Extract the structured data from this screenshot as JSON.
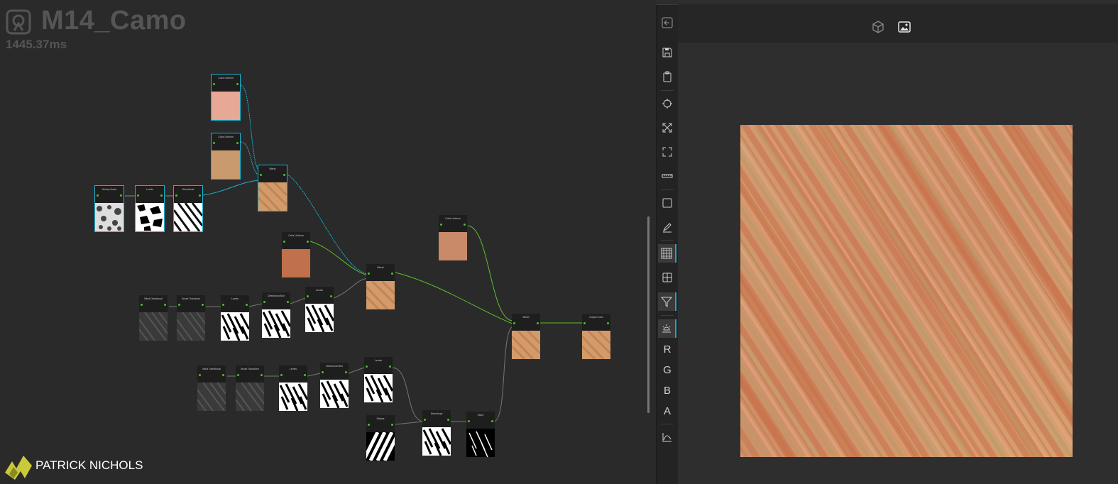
{
  "graph": {
    "title": "M14_Camo",
    "timing": "1445.37ms",
    "credit_name": "PATRICK NICHOLS",
    "nodes": [
      {
        "label": "Color Uniform",
        "thumb": "#e8a896",
        "sel": true
      },
      {
        "label": "Color Uniform",
        "thumb": "#c99a6e",
        "sel": true
      },
      {
        "label": "Blend",
        "thumb": "tex-tan",
        "sel": true
      },
      {
        "label": "Worley Noise",
        "thumb": "tex-worley",
        "sel": true
      },
      {
        "label": "Levels",
        "thumb": "tex-blot",
        "sel": true
      },
      {
        "label": "Directional",
        "thumb": "tex-streak",
        "sel": true
      },
      {
        "label": "Color Uniform",
        "thumb": "#c0704a",
        "sel": false
      },
      {
        "label": "Color Uniform",
        "thumb": "#c98a6a",
        "sel": false
      },
      {
        "label": "Blend",
        "thumb": "tex-tan",
        "sel": false
      },
      {
        "label": "Blend",
        "thumb": "tex-tan",
        "sel": false
      },
      {
        "label": "Output Color",
        "thumb": "tex-tan",
        "sel": false
      },
      {
        "label": "Wind Directional",
        "thumb": "tex-dark",
        "sel": false
      },
      {
        "label": "Smart Transform",
        "thumb": "tex-dark",
        "sel": false
      },
      {
        "label": "Levels",
        "thumb": "tex-bw",
        "sel": false
      },
      {
        "label": "Directional Blur",
        "thumb": "tex-bw",
        "sel": false
      },
      {
        "label": "Levels",
        "thumb": "tex-bw",
        "sel": false
      },
      {
        "label": "Wind Directional",
        "thumb": "tex-dark",
        "sel": false
      },
      {
        "label": "Smart Transform",
        "thumb": "tex-dark",
        "sel": false
      },
      {
        "label": "Levels",
        "thumb": "tex-bw",
        "sel": false
      },
      {
        "label": "Directional Blur",
        "thumb": "tex-bw",
        "sel": false
      },
      {
        "label": "Levels",
        "thumb": "tex-bw",
        "sel": false
      },
      {
        "label": "Stripes",
        "thumb": "tex-stripes",
        "sel": false
      },
      {
        "label": "Directional",
        "thumb": "tex-bw",
        "sel": false
      },
      {
        "label": "Invert",
        "thumb": "tex-black",
        "sel": false
      }
    ]
  },
  "toolbar": {
    "channels": [
      "R",
      "G",
      "B",
      "A"
    ]
  },
  "colors": {
    "selection": "#19b3d1",
    "wire_active": "#5fbf2a",
    "accent": "#18a7c9"
  }
}
